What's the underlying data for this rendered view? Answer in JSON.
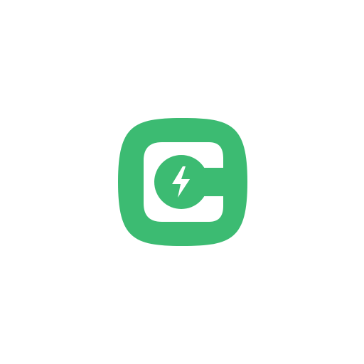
{
  "icon": {
    "name": "charging-app-icon",
    "shape": "squircle",
    "colors": {
      "brand_green": "#3CBB72",
      "inner_fill": "#FFFFFF",
      "canvas_background": "#FFFFFF"
    },
    "parts": [
      "c-shaped-plug-cutout",
      "circular-badge",
      "lightning-bolt-icon"
    ]
  }
}
